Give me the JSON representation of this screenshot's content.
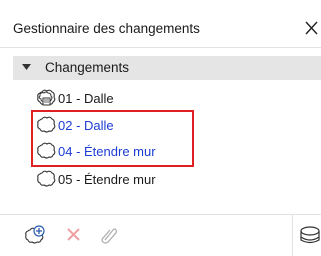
{
  "window": {
    "title": "Gestionnaire des changements"
  },
  "section": {
    "label": "Changements",
    "expanded": true
  },
  "items": [
    {
      "label": "01 - Dalle",
      "icon": "change-cloud-multi-icon",
      "selected": false
    },
    {
      "label": "02 - Dalle",
      "icon": "change-cloud-icon",
      "selected": true
    },
    {
      "label": "04 - Étendre mur",
      "icon": "change-cloud-icon",
      "selected": true
    },
    {
      "label": "05 - Étendre mur",
      "icon": "change-cloud-icon",
      "selected": false
    }
  ],
  "colors": {
    "selected_text": "#1c3dd4",
    "highlight": "#e02020",
    "delete": "#f0a0a0",
    "add": "#2a5db0"
  },
  "toolbar": {
    "buttons": [
      "add-change-icon",
      "delete-icon",
      "attach-icon",
      "stack-icon"
    ]
  }
}
